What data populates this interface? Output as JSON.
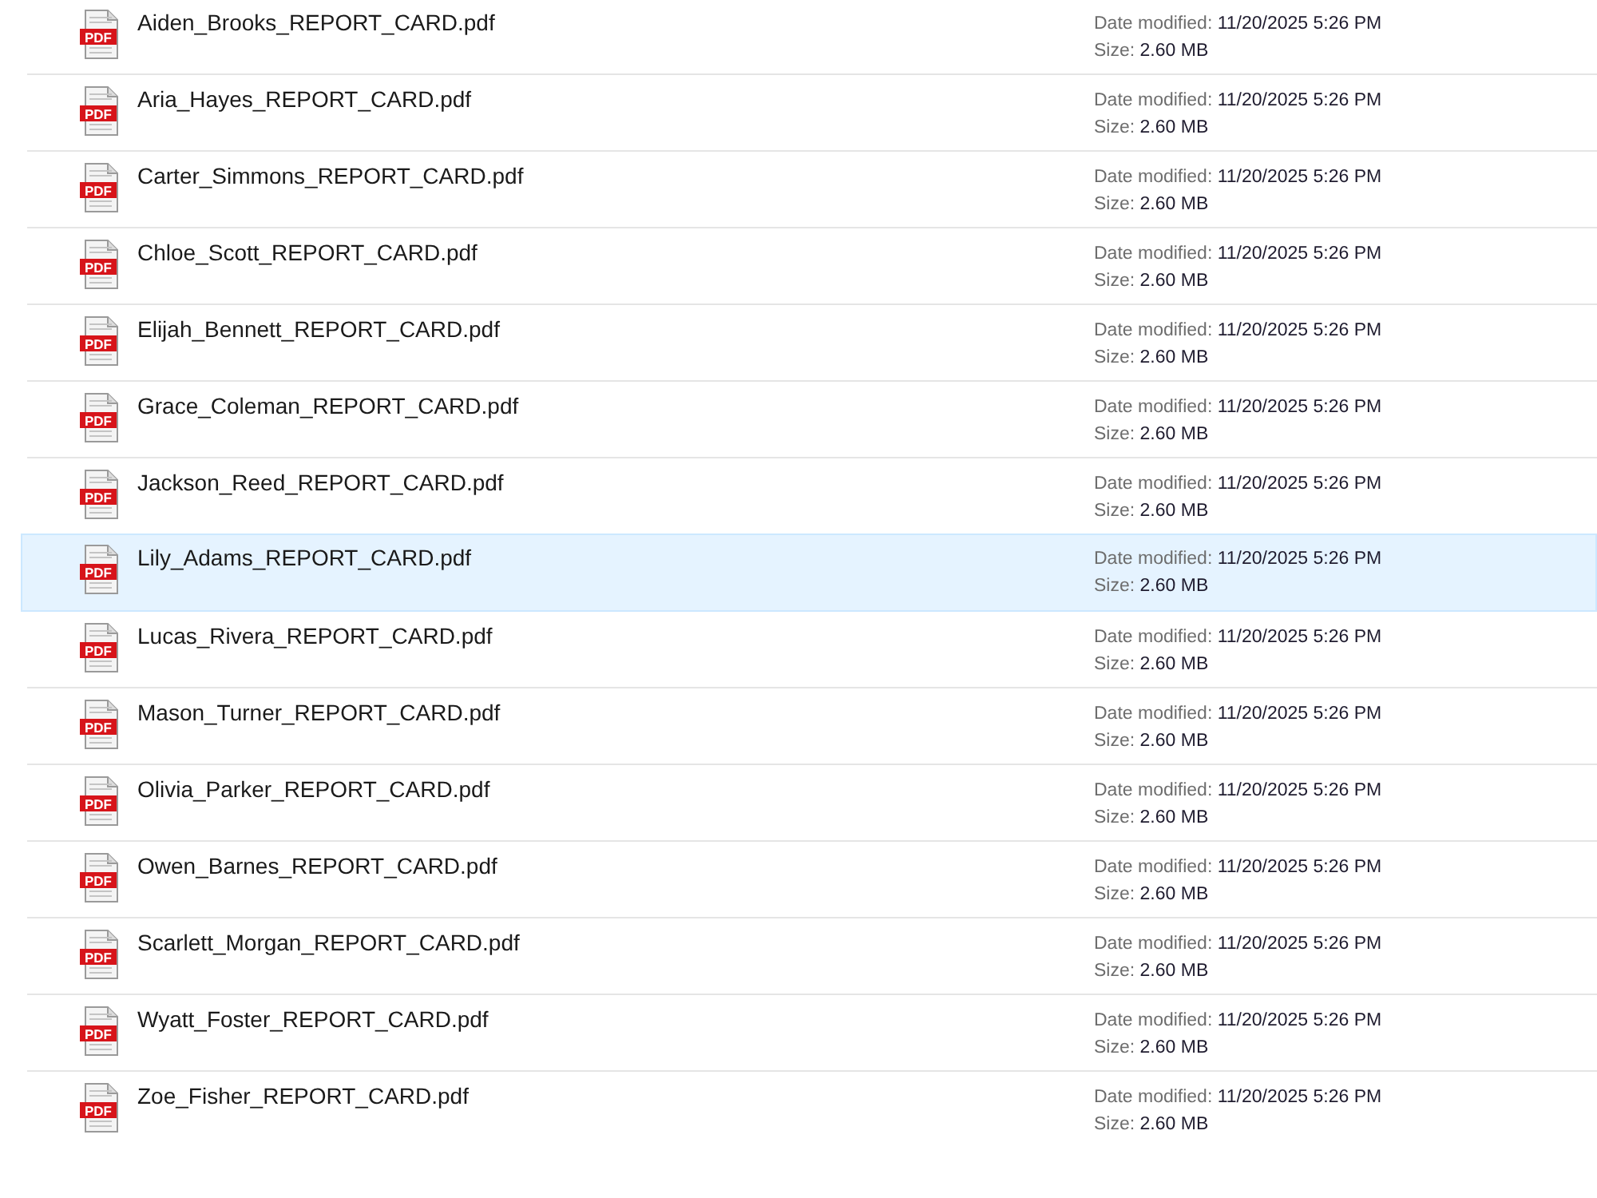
{
  "files": [
    {
      "icon_text": "PDF",
      "name": "Aiden_Brooks_REPORT_CARD.pdf",
      "date_label": "Date modified:",
      "date": "11/20/2025 5:26 PM",
      "size_label": "Size:",
      "size": "2.60 MB",
      "selected": false
    },
    {
      "icon_text": "PDF",
      "name": "Aria_Hayes_REPORT_CARD.pdf",
      "date_label": "Date modified:",
      "date": "11/20/2025 5:26 PM",
      "size_label": "Size:",
      "size": "2.60 MB",
      "selected": false
    },
    {
      "icon_text": "PDF",
      "name": "Carter_Simmons_REPORT_CARD.pdf",
      "date_label": "Date modified:",
      "date": "11/20/2025 5:26 PM",
      "size_label": "Size:",
      "size": "2.60 MB",
      "selected": false
    },
    {
      "icon_text": "PDF",
      "name": "Chloe_Scott_REPORT_CARD.pdf",
      "date_label": "Date modified:",
      "date": "11/20/2025 5:26 PM",
      "size_label": "Size:",
      "size": "2.60 MB",
      "selected": false
    },
    {
      "icon_text": "PDF",
      "name": "Elijah_Bennett_REPORT_CARD.pdf",
      "date_label": "Date modified:",
      "date": "11/20/2025 5:26 PM",
      "size_label": "Size:",
      "size": "2.60 MB",
      "selected": false
    },
    {
      "icon_text": "PDF",
      "name": "Grace_Coleman_REPORT_CARD.pdf",
      "date_label": "Date modified:",
      "date": "11/20/2025 5:26 PM",
      "size_label": "Size:",
      "size": "2.60 MB",
      "selected": false
    },
    {
      "icon_text": "PDF",
      "name": "Jackson_Reed_REPORT_CARD.pdf",
      "date_label": "Date modified:",
      "date": "11/20/2025 5:26 PM",
      "size_label": "Size:",
      "size": "2.60 MB",
      "selected": false
    },
    {
      "icon_text": "PDF",
      "name": "Lily_Adams_REPORT_CARD.pdf",
      "date_label": "Date modified:",
      "date": "11/20/2025 5:26 PM",
      "size_label": "Size:",
      "size": "2.60 MB",
      "selected": true
    },
    {
      "icon_text": "PDF",
      "name": "Lucas_Rivera_REPORT_CARD.pdf",
      "date_label": "Date modified:",
      "date": "11/20/2025 5:26 PM",
      "size_label": "Size:",
      "size": "2.60 MB",
      "selected": false
    },
    {
      "icon_text": "PDF",
      "name": "Mason_Turner_REPORT_CARD.pdf",
      "date_label": "Date modified:",
      "date": "11/20/2025 5:26 PM",
      "size_label": "Size:",
      "size": "2.60 MB",
      "selected": false
    },
    {
      "icon_text": "PDF",
      "name": "Olivia_Parker_REPORT_CARD.pdf",
      "date_label": "Date modified:",
      "date": "11/20/2025 5:26 PM",
      "size_label": "Size:",
      "size": "2.60 MB",
      "selected": false
    },
    {
      "icon_text": "PDF",
      "name": "Owen_Barnes_REPORT_CARD.pdf",
      "date_label": "Date modified:",
      "date": "11/20/2025 5:26 PM",
      "size_label": "Size:",
      "size": "2.60 MB",
      "selected": false
    },
    {
      "icon_text": "PDF",
      "name": "Scarlett_Morgan_REPORT_CARD.pdf",
      "date_label": "Date modified:",
      "date": "11/20/2025 5:26 PM",
      "size_label": "Size:",
      "size": "2.60 MB",
      "selected": false
    },
    {
      "icon_text": "PDF",
      "name": "Wyatt_Foster_REPORT_CARD.pdf",
      "date_label": "Date modified:",
      "date": "11/20/2025 5:26 PM",
      "size_label": "Size:",
      "size": "2.60 MB",
      "selected": false
    },
    {
      "icon_text": "PDF",
      "name": "Zoe_Fisher_REPORT_CARD.pdf",
      "date_label": "Date modified:",
      "date": "11/20/2025 5:26 PM",
      "size_label": "Size:",
      "size": "2.60 MB",
      "selected": false
    }
  ]
}
